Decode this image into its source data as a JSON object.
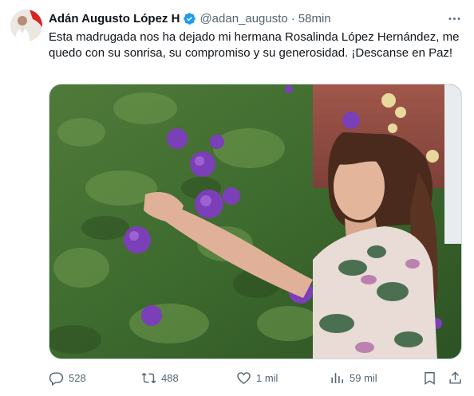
{
  "author": {
    "display_name": "Adán Augusto López H",
    "handle": "@adan_augusto",
    "separator": "·",
    "time": "58min"
  },
  "tweet": {
    "text": "Esta madrugada nos ha dejado mi hermana Rosalinda López Hernández, me quedo con su sonrisa, su compromiso y su generosidad. ¡Descanse en Paz!"
  },
  "icons": {
    "avatar": "avatar-photo",
    "verified": "verified-badge-icon",
    "more": "more-icon",
    "reply": "reply-icon",
    "retweet": "retweet-icon",
    "like": "like-icon",
    "views": "views-icon",
    "bookmark": "bookmark-icon",
    "share": "share-icon"
  },
  "stats": {
    "replies": "528",
    "retweets": "488",
    "likes": "1 mil",
    "views": "59 mil"
  },
  "colors": {
    "verified": "#1d9bf0",
    "secondary_text": "#536471",
    "primary_text": "#0f1419"
  }
}
